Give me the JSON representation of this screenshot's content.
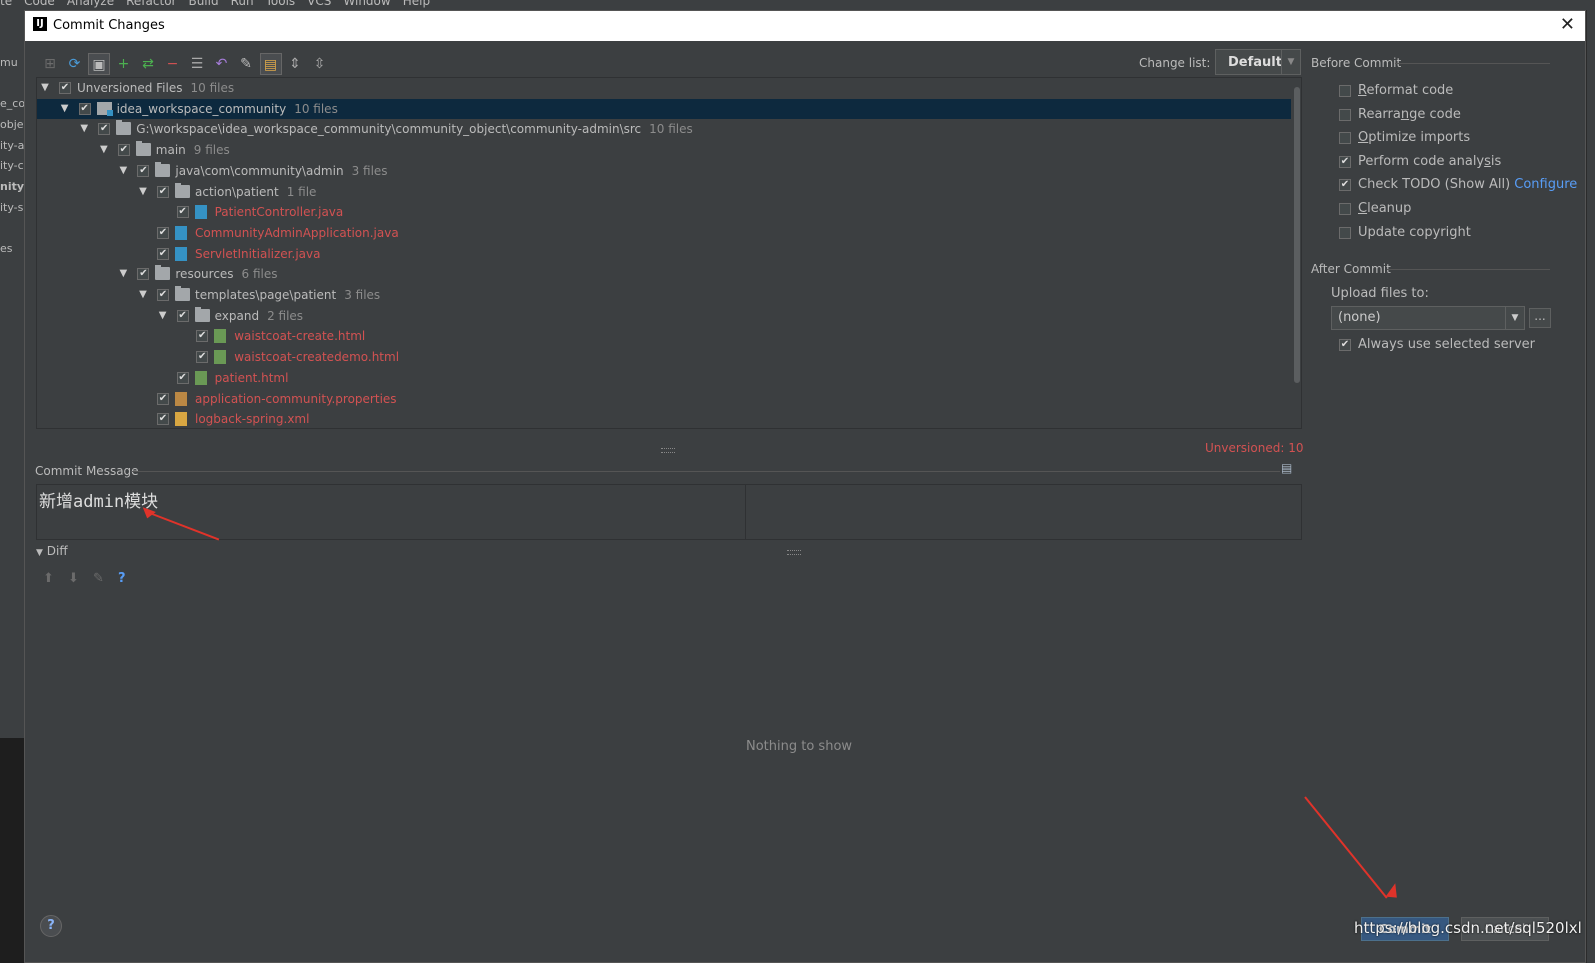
{
  "ide": {
    "menu": [
      "te",
      "Code",
      "Analyze",
      "Refactor",
      "Build",
      "Run",
      "Tools",
      "VCS",
      "Window",
      "Help"
    ],
    "left_fragments": [
      "mu",
      "e_co",
      "obje",
      "ity-a",
      "ity-c",
      "nity-",
      "ity-s",
      "es"
    ]
  },
  "dialog": {
    "title": "Commit Changes",
    "app_icon": "IJ",
    "close_glyph": "✕"
  },
  "toolbar": {
    "icons": [
      "lock-icon",
      "refresh-icon",
      "group-icon",
      "add-icon",
      "move-icon",
      "remove-icon",
      "diff-icon",
      "rollback-icon",
      "edit-source-icon",
      "layout-icon",
      "expand-all-icon",
      "collapse-all-icon"
    ],
    "glyphs": [
      "⊞",
      "⟳",
      "▣",
      "+",
      "⇄",
      "−",
      "☰",
      "↶",
      "✎",
      "▤",
      "⇕",
      "⇳"
    ],
    "colors": [
      "#6b6b6b",
      "#4a9bd8",
      "#bbbbbb",
      "#4caf50",
      "#4caf50",
      "#d25252",
      "#aaaaaa",
      "#a57cd8",
      "#bbbbbb",
      "#dda84a",
      "#aaaaaa",
      "#aaaaaa"
    ]
  },
  "changelist": {
    "label": "Change list:",
    "value": "Default"
  },
  "tree": {
    "rows": [
      {
        "name": "Unversioned Files",
        "count": "10 files",
        "level": 0,
        "expanded": true,
        "icon": "none",
        "red": false,
        "selected": false
      },
      {
        "name": "idea_workspace_community",
        "count": "10 files",
        "level": 1,
        "expanded": true,
        "icon": "module-folder",
        "red": false,
        "selected": true
      },
      {
        "name": "G:\\workspace\\idea_workspace_community\\community_object\\community-admin\\src",
        "count": "10 files",
        "level": 2,
        "expanded": true,
        "icon": "folder",
        "red": false,
        "selected": false
      },
      {
        "name": "main",
        "count": "9 files",
        "level": 3,
        "expanded": true,
        "icon": "folder",
        "red": false,
        "selected": false
      },
      {
        "name": "java\\com\\community\\admin",
        "count": "3 files",
        "level": 4,
        "expanded": true,
        "icon": "folder",
        "red": false,
        "selected": false
      },
      {
        "name": "action\\patient",
        "count": "1 file",
        "level": 5,
        "expanded": true,
        "icon": "folder",
        "red": false,
        "selected": false
      },
      {
        "name": "PatientController.java",
        "count": "",
        "level": 6,
        "expanded": false,
        "icon": "java-file",
        "red": true,
        "selected": false
      },
      {
        "name": "CommunityAdminApplication.java",
        "count": "",
        "level": 5,
        "expanded": false,
        "icon": "java-file",
        "red": true,
        "selected": false
      },
      {
        "name": "ServletInitializer.java",
        "count": "",
        "level": 5,
        "expanded": false,
        "icon": "java-file",
        "red": true,
        "selected": false
      },
      {
        "name": "resources",
        "count": "6 files",
        "level": 4,
        "expanded": true,
        "icon": "folder",
        "red": false,
        "selected": false
      },
      {
        "name": "templates\\page\\patient",
        "count": "3 files",
        "level": 5,
        "expanded": true,
        "icon": "folder",
        "red": false,
        "selected": false
      },
      {
        "name": "expand",
        "count": "2 files",
        "level": 6,
        "expanded": true,
        "icon": "folder",
        "red": false,
        "selected": false
      },
      {
        "name": "waistcoat-create.html",
        "count": "",
        "level": 7,
        "expanded": false,
        "icon": "html-file",
        "red": true,
        "selected": false
      },
      {
        "name": "waistcoat-createdemo.html",
        "count": "",
        "level": 7,
        "expanded": false,
        "icon": "html-file",
        "red": true,
        "selected": false
      },
      {
        "name": "patient.html",
        "count": "",
        "level": 6,
        "expanded": false,
        "icon": "html-file",
        "red": true,
        "selected": false
      },
      {
        "name": "application-community.properties",
        "count": "",
        "level": 5,
        "expanded": false,
        "icon": "props-file",
        "red": true,
        "selected": false
      },
      {
        "name": "logback-spring.xml",
        "count": "",
        "level": 5,
        "expanded": false,
        "icon": "xml-file",
        "red": true,
        "selected": false
      }
    ],
    "status": "Unversioned: 10"
  },
  "commit_message": {
    "label": "Commit Message",
    "text": "新增admin模块"
  },
  "diff": {
    "label": "Diff",
    "tool_icons": [
      "arrow-up-icon",
      "arrow-down-icon",
      "edit-icon",
      "help-icon"
    ],
    "tool_glyphs": [
      "⬆",
      "⬇",
      "✎",
      "?"
    ],
    "empty": "Nothing to show"
  },
  "before_commit": {
    "title": "Before Commit",
    "options": [
      {
        "pre": "",
        "mn": "R",
        "post": "eformat code",
        "checked": false
      },
      {
        "pre": "Rearra",
        "mn": "n",
        "post": "ge code",
        "checked": false
      },
      {
        "pre": "",
        "mn": "O",
        "post": "ptimize imports",
        "checked": false
      },
      {
        "pre": "Perform code analy",
        "mn": "s",
        "post": "is",
        "checked": true
      },
      {
        "pre": "Check TODO (Show All)",
        "mn": "",
        "post": "",
        "checked": true
      },
      {
        "pre": "",
        "mn": "C",
        "post": "leanup",
        "checked": false
      },
      {
        "pre": "Update copyright",
        "mn": "",
        "post": "",
        "checked": false
      }
    ],
    "configure": "Configure"
  },
  "after_commit": {
    "title": "After Commit",
    "upload_label": "Upload files to:",
    "upload_value": "(none)",
    "browse": "...",
    "always_label": "Always use selected server",
    "always_checked": true
  },
  "buttons": {
    "help": "?",
    "commit": "Commit",
    "cancel": "Cancel"
  },
  "watermark": "https://blog.csdn.net/sql520lxl",
  "colors": {
    "accent_red": "#d25252",
    "annotation_red": "#e0332a",
    "link_blue": "#589df6",
    "selection": "#0d293e"
  }
}
